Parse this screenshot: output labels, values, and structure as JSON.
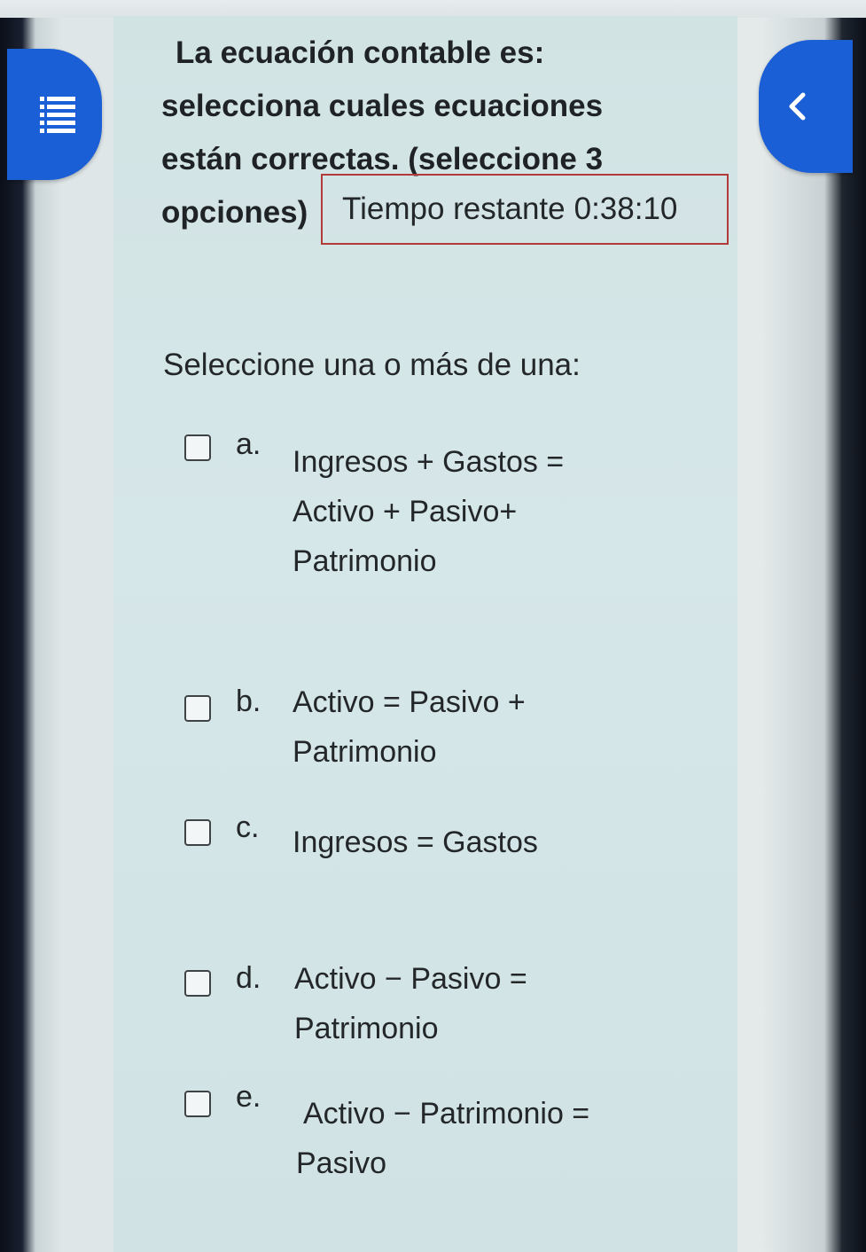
{
  "question": {
    "lines": [
      "La ecuación contable es:",
      "selecciona cuales ecuaciones",
      "están correctas. (seleccione 3",
      "opciones)"
    ]
  },
  "timer": {
    "label": "Tiempo restante",
    "value": "0:38:10"
  },
  "prompt": "Seleccione una o más de una:",
  "options": [
    {
      "letter": "a.",
      "lines": [
        "Ingresos + Gastos =",
        "Activo + Pasivo+",
        "Patrimonio"
      ],
      "checked": false
    },
    {
      "letter": "b.",
      "lines": [
        "Activo = Pasivo +",
        "Patrimonio"
      ],
      "checked": false
    },
    {
      "letter": "c.",
      "lines": [
        "Ingresos = Gastos"
      ],
      "checked": false
    },
    {
      "letter": "d.",
      "lines": [
        "Activo − Pasivo =",
        "Patrimonio"
      ],
      "checked": false
    },
    {
      "letter": "e.",
      "lines": [
        "Activo − Patrimonio =",
        "Pasivo"
      ],
      "checked": false
    }
  ],
  "icons": {
    "left_button": "list-icon",
    "right_button": "chevron-left-icon"
  },
  "colors": {
    "accent": "#1a5fd6",
    "timer_border": "#b33a3a",
    "panel_bg": "#d4e5e7"
  }
}
